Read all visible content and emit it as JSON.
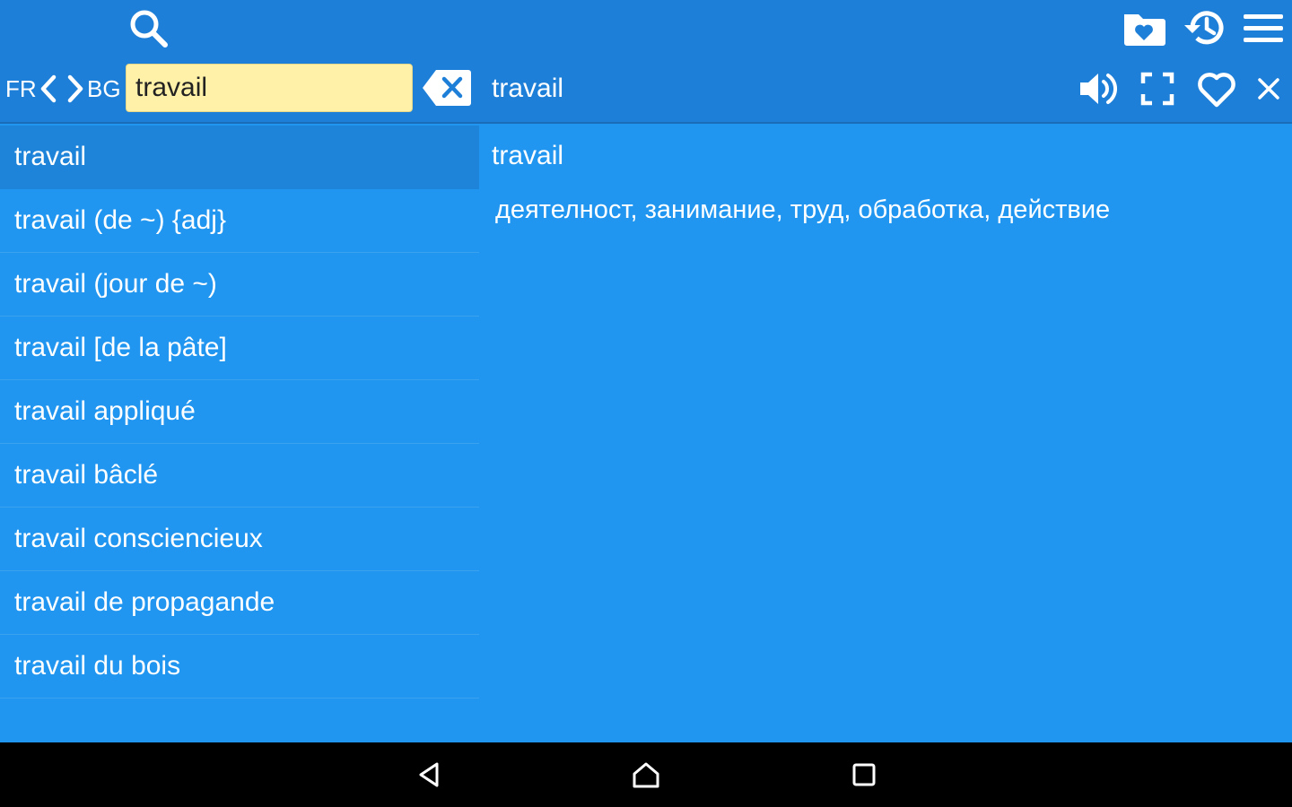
{
  "header": {
    "source_lang": "FR",
    "target_lang": "BG",
    "search_value": "travail",
    "search_placeholder": "",
    "entry_title": "travail"
  },
  "icons": {
    "search": "search-icon",
    "favorites_folder": "favorites-folder-icon",
    "history": "history-icon",
    "menu": "menu-icon",
    "swap": "swap-languages-icon",
    "clear": "clear-icon",
    "speaker": "speaker-icon",
    "fullscreen": "fullscreen-icon",
    "favorite": "heart-icon",
    "close": "close-icon"
  },
  "results": {
    "items": [
      "travail",
      "travail (de ~) {adj}",
      "travail (jour de ~)",
      "travail [de la pâte]",
      "travail appliqué",
      "travail bâclé",
      "travail consciencieux",
      "travail de propagande",
      "travail du bois"
    ],
    "selected_index": 0
  },
  "detail": {
    "word": "travail",
    "definition": "деятелност, занимание, труд, обработка, действие"
  },
  "colors": {
    "toolbar": "#1e7fd8",
    "content": "#2196f0",
    "selected_row": "#1d84d9",
    "search_field": "#fff2a8",
    "navbar": "#000000"
  }
}
